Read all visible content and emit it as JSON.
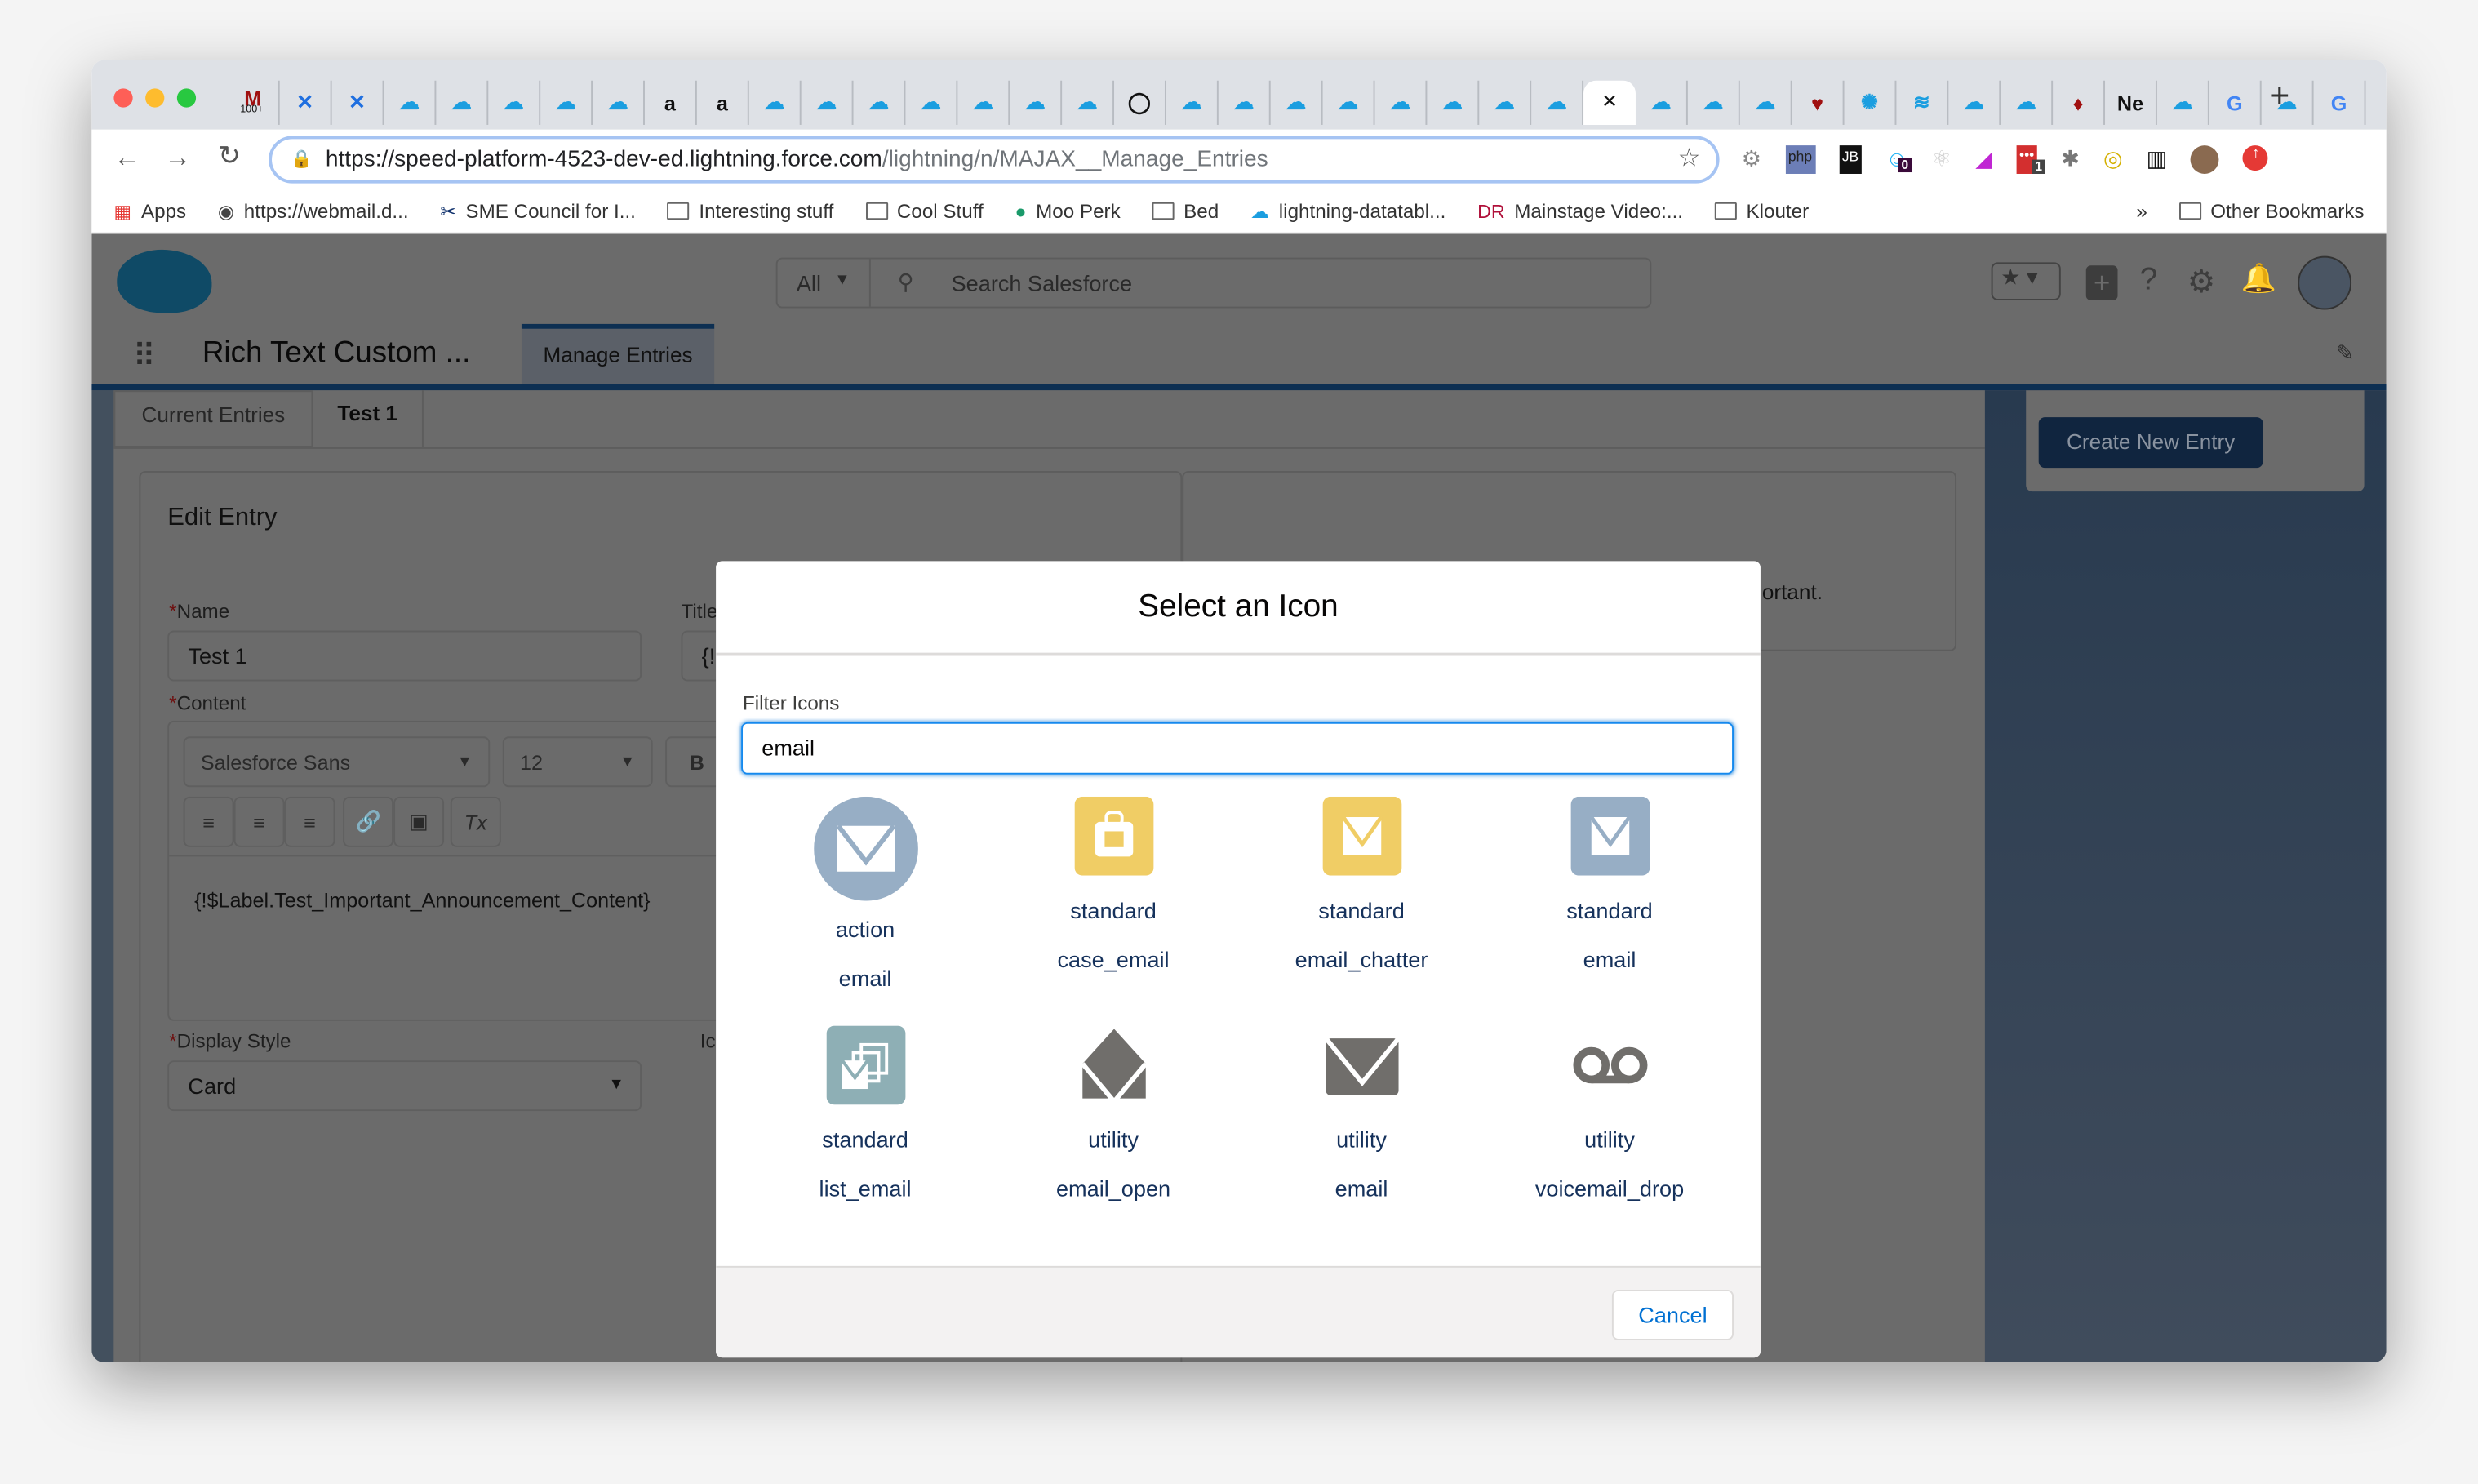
{
  "browser": {
    "tabs": [
      "M",
      "✕",
      "✕",
      "☁",
      "☁",
      "☁",
      "☁",
      "☁",
      "a",
      "a",
      "☁",
      "☁",
      "☁",
      "☁",
      "☁",
      "☁",
      "☁",
      "◯",
      "☁",
      "☁",
      "☁",
      "☁",
      "☁",
      "☁",
      "☁",
      "☁",
      "×",
      "☁",
      "☁",
      "☁",
      "♥",
      "✺",
      "≋",
      "☁",
      "☁",
      "♦",
      "Ne",
      "☁",
      "G",
      "☁",
      "G"
    ],
    "active_tab_index": 26,
    "gmail_badge": "100+",
    "new_tab": "+",
    "url_host": "https://speed-platform-4523-dev-ed.lightning.force.com",
    "url_path": "/lightning/n/MAJAX__Manage_Entries",
    "extension_badges": [
      "0",
      "1"
    ],
    "bookmarks": [
      "Apps",
      "https://webmail.d...",
      "SME Council for I...",
      "Interesting stuff",
      "Cool Stuff",
      "Moo Perk",
      "Bed",
      "lightning-datatabl...",
      "Mainstage Video:...",
      "Klouter"
    ],
    "more": "»",
    "other_bookmarks": "Other Bookmarks"
  },
  "header": {
    "search_scope": "All",
    "search_placeholder": "Search Salesforce"
  },
  "nav": {
    "app_name": "Rich Text Custom ...",
    "tab": "Manage Entries"
  },
  "page": {
    "tabs": [
      "Current Entries",
      "Test 1"
    ],
    "card_title": "Edit Entry",
    "name_label": "Name",
    "name_value": "Test 1",
    "title_label": "Title",
    "title_value": "{!",
    "content_label": "Content",
    "font_value": "Salesforce Sans",
    "size_value": "12",
    "bold": "B",
    "content_value": "{!$Label.Test_Important_Announcement_Content}",
    "display_label": "Display Style",
    "display_value": "Card",
    "icon_label": "Ic",
    "right_text": "ortant.",
    "create_button": "Create New Entry"
  },
  "modal": {
    "title": "Select an Icon",
    "filter_label": "Filter Icons",
    "filter_value": "email",
    "icons": [
      {
        "category": "action",
        "name": "email"
      },
      {
        "category": "standard",
        "name": "case_email"
      },
      {
        "category": "standard",
        "name": "email_chatter"
      },
      {
        "category": "standard",
        "name": "email"
      },
      {
        "category": "standard",
        "name": "list_email"
      },
      {
        "category": "utility",
        "name": "email_open"
      },
      {
        "category": "utility",
        "name": "email"
      },
      {
        "category": "utility",
        "name": "voicemail_drop"
      }
    ],
    "cancel": "Cancel"
  },
  "colors": {
    "brand_dark": "#0d2f52",
    "link": "#16325c",
    "action_blue": "#0070d2",
    "icon_gray_blue": "#97aec5",
    "icon_yellow": "#f0cd65",
    "icon_teal": "#8eafb5",
    "utility_gray": "#706e6b"
  }
}
